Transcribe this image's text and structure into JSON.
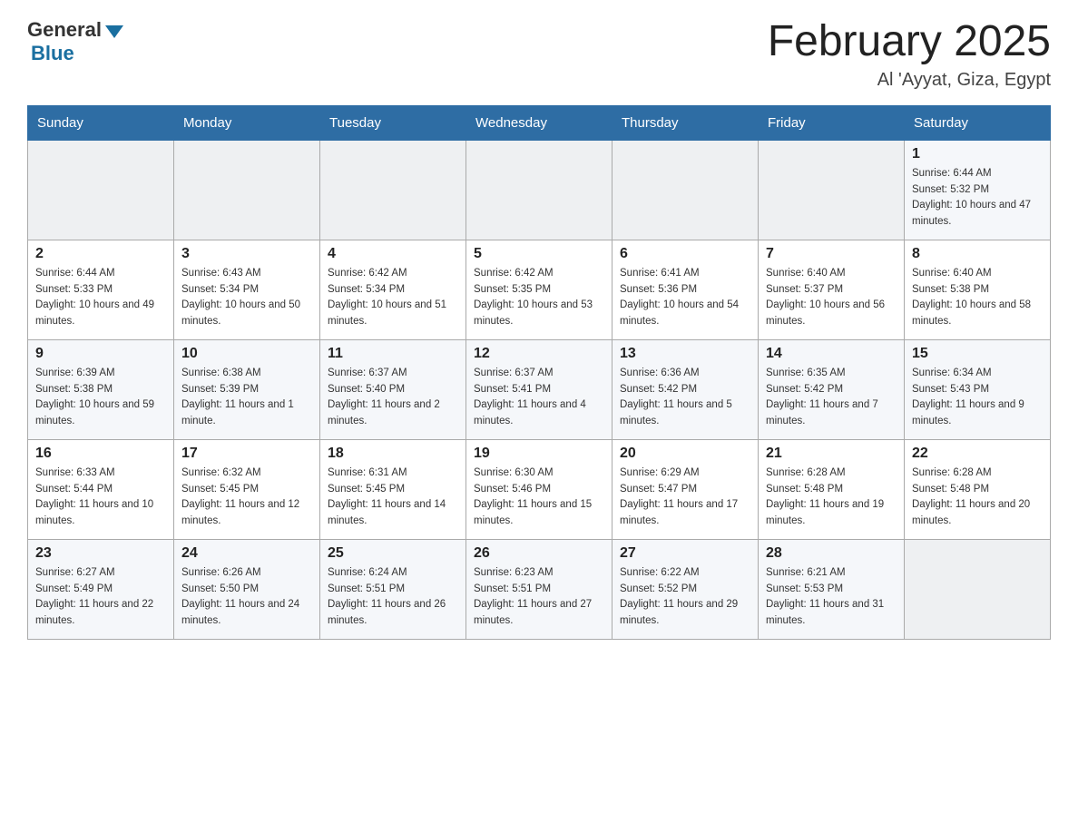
{
  "header": {
    "logo_general": "General",
    "logo_blue": "Blue",
    "title": "February 2025",
    "subtitle": "Al 'Ayyat, Giza, Egypt"
  },
  "days_of_week": [
    "Sunday",
    "Monday",
    "Tuesday",
    "Wednesday",
    "Thursday",
    "Friday",
    "Saturday"
  ],
  "weeks": [
    [
      {
        "day": "",
        "info": ""
      },
      {
        "day": "",
        "info": ""
      },
      {
        "day": "",
        "info": ""
      },
      {
        "day": "",
        "info": ""
      },
      {
        "day": "",
        "info": ""
      },
      {
        "day": "",
        "info": ""
      },
      {
        "day": "1",
        "info": "Sunrise: 6:44 AM\nSunset: 5:32 PM\nDaylight: 10 hours and 47 minutes."
      }
    ],
    [
      {
        "day": "2",
        "info": "Sunrise: 6:44 AM\nSunset: 5:33 PM\nDaylight: 10 hours and 49 minutes."
      },
      {
        "day": "3",
        "info": "Sunrise: 6:43 AM\nSunset: 5:34 PM\nDaylight: 10 hours and 50 minutes."
      },
      {
        "day": "4",
        "info": "Sunrise: 6:42 AM\nSunset: 5:34 PM\nDaylight: 10 hours and 51 minutes."
      },
      {
        "day": "5",
        "info": "Sunrise: 6:42 AM\nSunset: 5:35 PM\nDaylight: 10 hours and 53 minutes."
      },
      {
        "day": "6",
        "info": "Sunrise: 6:41 AM\nSunset: 5:36 PM\nDaylight: 10 hours and 54 minutes."
      },
      {
        "day": "7",
        "info": "Sunrise: 6:40 AM\nSunset: 5:37 PM\nDaylight: 10 hours and 56 minutes."
      },
      {
        "day": "8",
        "info": "Sunrise: 6:40 AM\nSunset: 5:38 PM\nDaylight: 10 hours and 58 minutes."
      }
    ],
    [
      {
        "day": "9",
        "info": "Sunrise: 6:39 AM\nSunset: 5:38 PM\nDaylight: 10 hours and 59 minutes."
      },
      {
        "day": "10",
        "info": "Sunrise: 6:38 AM\nSunset: 5:39 PM\nDaylight: 11 hours and 1 minute."
      },
      {
        "day": "11",
        "info": "Sunrise: 6:37 AM\nSunset: 5:40 PM\nDaylight: 11 hours and 2 minutes."
      },
      {
        "day": "12",
        "info": "Sunrise: 6:37 AM\nSunset: 5:41 PM\nDaylight: 11 hours and 4 minutes."
      },
      {
        "day": "13",
        "info": "Sunrise: 6:36 AM\nSunset: 5:42 PM\nDaylight: 11 hours and 5 minutes."
      },
      {
        "day": "14",
        "info": "Sunrise: 6:35 AM\nSunset: 5:42 PM\nDaylight: 11 hours and 7 minutes."
      },
      {
        "day": "15",
        "info": "Sunrise: 6:34 AM\nSunset: 5:43 PM\nDaylight: 11 hours and 9 minutes."
      }
    ],
    [
      {
        "day": "16",
        "info": "Sunrise: 6:33 AM\nSunset: 5:44 PM\nDaylight: 11 hours and 10 minutes."
      },
      {
        "day": "17",
        "info": "Sunrise: 6:32 AM\nSunset: 5:45 PM\nDaylight: 11 hours and 12 minutes."
      },
      {
        "day": "18",
        "info": "Sunrise: 6:31 AM\nSunset: 5:45 PM\nDaylight: 11 hours and 14 minutes."
      },
      {
        "day": "19",
        "info": "Sunrise: 6:30 AM\nSunset: 5:46 PM\nDaylight: 11 hours and 15 minutes."
      },
      {
        "day": "20",
        "info": "Sunrise: 6:29 AM\nSunset: 5:47 PM\nDaylight: 11 hours and 17 minutes."
      },
      {
        "day": "21",
        "info": "Sunrise: 6:28 AM\nSunset: 5:48 PM\nDaylight: 11 hours and 19 minutes."
      },
      {
        "day": "22",
        "info": "Sunrise: 6:28 AM\nSunset: 5:48 PM\nDaylight: 11 hours and 20 minutes."
      }
    ],
    [
      {
        "day": "23",
        "info": "Sunrise: 6:27 AM\nSunset: 5:49 PM\nDaylight: 11 hours and 22 minutes."
      },
      {
        "day": "24",
        "info": "Sunrise: 6:26 AM\nSunset: 5:50 PM\nDaylight: 11 hours and 24 minutes."
      },
      {
        "day": "25",
        "info": "Sunrise: 6:24 AM\nSunset: 5:51 PM\nDaylight: 11 hours and 26 minutes."
      },
      {
        "day": "26",
        "info": "Sunrise: 6:23 AM\nSunset: 5:51 PM\nDaylight: 11 hours and 27 minutes."
      },
      {
        "day": "27",
        "info": "Sunrise: 6:22 AM\nSunset: 5:52 PM\nDaylight: 11 hours and 29 minutes."
      },
      {
        "day": "28",
        "info": "Sunrise: 6:21 AM\nSunset: 5:53 PM\nDaylight: 11 hours and 31 minutes."
      },
      {
        "day": "",
        "info": ""
      }
    ]
  ]
}
